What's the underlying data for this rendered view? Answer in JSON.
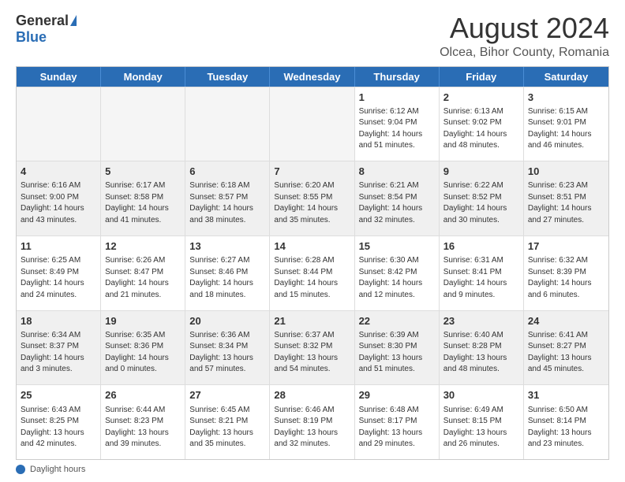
{
  "header": {
    "logo_general": "General",
    "logo_blue": "Blue",
    "main_title": "August 2024",
    "subtitle": "Olcea, Bihor County, Romania"
  },
  "calendar": {
    "days_of_week": [
      "Sunday",
      "Monday",
      "Tuesday",
      "Wednesday",
      "Thursday",
      "Friday",
      "Saturday"
    ],
    "weeks": [
      {
        "cells": [
          {
            "empty": true
          },
          {
            "empty": true
          },
          {
            "empty": true
          },
          {
            "empty": true
          },
          {
            "day": "1",
            "lines": [
              "Sunrise: 6:12 AM",
              "Sunset: 9:04 PM",
              "Daylight: 14 hours",
              "and 51 minutes."
            ]
          },
          {
            "day": "2",
            "lines": [
              "Sunrise: 6:13 AM",
              "Sunset: 9:02 PM",
              "Daylight: 14 hours",
              "and 48 minutes."
            ]
          },
          {
            "day": "3",
            "lines": [
              "Sunrise: 6:15 AM",
              "Sunset: 9:01 PM",
              "Daylight: 14 hours",
              "and 46 minutes."
            ]
          }
        ]
      },
      {
        "cells": [
          {
            "day": "4",
            "lines": [
              "Sunrise: 6:16 AM",
              "Sunset: 9:00 PM",
              "Daylight: 14 hours",
              "and 43 minutes."
            ]
          },
          {
            "day": "5",
            "lines": [
              "Sunrise: 6:17 AM",
              "Sunset: 8:58 PM",
              "Daylight: 14 hours",
              "and 41 minutes."
            ]
          },
          {
            "day": "6",
            "lines": [
              "Sunrise: 6:18 AM",
              "Sunset: 8:57 PM",
              "Daylight: 14 hours",
              "and 38 minutes."
            ]
          },
          {
            "day": "7",
            "lines": [
              "Sunrise: 6:20 AM",
              "Sunset: 8:55 PM",
              "Daylight: 14 hours",
              "and 35 minutes."
            ]
          },
          {
            "day": "8",
            "lines": [
              "Sunrise: 6:21 AM",
              "Sunset: 8:54 PM",
              "Daylight: 14 hours",
              "and 32 minutes."
            ]
          },
          {
            "day": "9",
            "lines": [
              "Sunrise: 6:22 AM",
              "Sunset: 8:52 PM",
              "Daylight: 14 hours",
              "and 30 minutes."
            ]
          },
          {
            "day": "10",
            "lines": [
              "Sunrise: 6:23 AM",
              "Sunset: 8:51 PM",
              "Daylight: 14 hours",
              "and 27 minutes."
            ]
          }
        ]
      },
      {
        "cells": [
          {
            "day": "11",
            "lines": [
              "Sunrise: 6:25 AM",
              "Sunset: 8:49 PM",
              "Daylight: 14 hours",
              "and 24 minutes."
            ]
          },
          {
            "day": "12",
            "lines": [
              "Sunrise: 6:26 AM",
              "Sunset: 8:47 PM",
              "Daylight: 14 hours",
              "and 21 minutes."
            ]
          },
          {
            "day": "13",
            "lines": [
              "Sunrise: 6:27 AM",
              "Sunset: 8:46 PM",
              "Daylight: 14 hours",
              "and 18 minutes."
            ]
          },
          {
            "day": "14",
            "lines": [
              "Sunrise: 6:28 AM",
              "Sunset: 8:44 PM",
              "Daylight: 14 hours",
              "and 15 minutes."
            ]
          },
          {
            "day": "15",
            "lines": [
              "Sunrise: 6:30 AM",
              "Sunset: 8:42 PM",
              "Daylight: 14 hours",
              "and 12 minutes."
            ]
          },
          {
            "day": "16",
            "lines": [
              "Sunrise: 6:31 AM",
              "Sunset: 8:41 PM",
              "Daylight: 14 hours",
              "and 9 minutes."
            ]
          },
          {
            "day": "17",
            "lines": [
              "Sunrise: 6:32 AM",
              "Sunset: 8:39 PM",
              "Daylight: 14 hours",
              "and 6 minutes."
            ]
          }
        ]
      },
      {
        "cells": [
          {
            "day": "18",
            "lines": [
              "Sunrise: 6:34 AM",
              "Sunset: 8:37 PM",
              "Daylight: 14 hours",
              "and 3 minutes."
            ]
          },
          {
            "day": "19",
            "lines": [
              "Sunrise: 6:35 AM",
              "Sunset: 8:36 PM",
              "Daylight: 14 hours",
              "and 0 minutes."
            ]
          },
          {
            "day": "20",
            "lines": [
              "Sunrise: 6:36 AM",
              "Sunset: 8:34 PM",
              "Daylight: 13 hours",
              "and 57 minutes."
            ]
          },
          {
            "day": "21",
            "lines": [
              "Sunrise: 6:37 AM",
              "Sunset: 8:32 PM",
              "Daylight: 13 hours",
              "and 54 minutes."
            ]
          },
          {
            "day": "22",
            "lines": [
              "Sunrise: 6:39 AM",
              "Sunset: 8:30 PM",
              "Daylight: 13 hours",
              "and 51 minutes."
            ]
          },
          {
            "day": "23",
            "lines": [
              "Sunrise: 6:40 AM",
              "Sunset: 8:28 PM",
              "Daylight: 13 hours",
              "and 48 minutes."
            ]
          },
          {
            "day": "24",
            "lines": [
              "Sunrise: 6:41 AM",
              "Sunset: 8:27 PM",
              "Daylight: 13 hours",
              "and 45 minutes."
            ]
          }
        ]
      },
      {
        "cells": [
          {
            "day": "25",
            "lines": [
              "Sunrise: 6:43 AM",
              "Sunset: 8:25 PM",
              "Daylight: 13 hours",
              "and 42 minutes."
            ]
          },
          {
            "day": "26",
            "lines": [
              "Sunrise: 6:44 AM",
              "Sunset: 8:23 PM",
              "Daylight: 13 hours",
              "and 39 minutes."
            ]
          },
          {
            "day": "27",
            "lines": [
              "Sunrise: 6:45 AM",
              "Sunset: 8:21 PM",
              "Daylight: 13 hours",
              "and 35 minutes."
            ]
          },
          {
            "day": "28",
            "lines": [
              "Sunrise: 6:46 AM",
              "Sunset: 8:19 PM",
              "Daylight: 13 hours",
              "and 32 minutes."
            ]
          },
          {
            "day": "29",
            "lines": [
              "Sunrise: 6:48 AM",
              "Sunset: 8:17 PM",
              "Daylight: 13 hours",
              "and 29 minutes."
            ]
          },
          {
            "day": "30",
            "lines": [
              "Sunrise: 6:49 AM",
              "Sunset: 8:15 PM",
              "Daylight: 13 hours",
              "and 26 minutes."
            ]
          },
          {
            "day": "31",
            "lines": [
              "Sunrise: 6:50 AM",
              "Sunset: 8:14 PM",
              "Daylight: 13 hours",
              "and 23 minutes."
            ]
          }
        ]
      }
    ]
  },
  "footer": {
    "daylight_label": "Daylight hours"
  }
}
